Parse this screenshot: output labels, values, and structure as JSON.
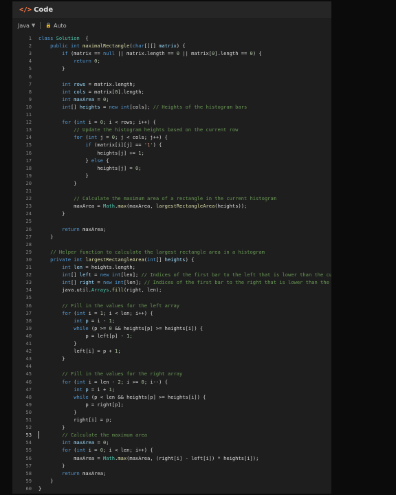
{
  "header": {
    "icon": "code-icon",
    "title": "Code"
  },
  "toolbar": {
    "language": "Java",
    "mode": "Auto"
  },
  "editor": {
    "lines": [
      {
        "n": "1",
        "t": [
          [
            "kw",
            "class "
          ],
          [
            "ty",
            "Solution"
          ],
          [
            "",
            "  {"
          ]
        ]
      },
      {
        "n": "2",
        "t": [
          [
            "",
            "    "
          ],
          [
            "kw",
            "public int "
          ],
          [
            "fn",
            "maximalRectangle"
          ],
          [
            "",
            "("
          ],
          [
            "kw",
            "char"
          ],
          [
            "",
            "[][] "
          ],
          [
            "id",
            "matrix"
          ],
          [
            "",
            ") {"
          ]
        ]
      },
      {
        "n": "3",
        "t": [
          [
            "",
            "        "
          ],
          [
            "kw",
            "if"
          ],
          [
            "",
            " (matrix == "
          ],
          [
            "kw",
            "null"
          ],
          [
            "",
            " || matrix.length == "
          ],
          [
            "num",
            "0"
          ],
          [
            "",
            " || matrix["
          ],
          [
            "num",
            "0"
          ],
          [
            "",
            "].length == "
          ],
          [
            "num",
            "0"
          ],
          [
            "",
            ") {"
          ]
        ]
      },
      {
        "n": "4",
        "t": [
          [
            "",
            "            "
          ],
          [
            "kw",
            "return "
          ],
          [
            "num",
            "0"
          ],
          [
            "",
            ";"
          ]
        ]
      },
      {
        "n": "5",
        "t": [
          [
            "",
            "        }"
          ]
        ]
      },
      {
        "n": "6",
        "t": []
      },
      {
        "n": "7",
        "t": [
          [
            "",
            "        "
          ],
          [
            "kw",
            "int "
          ],
          [
            "id",
            "rows"
          ],
          [
            "",
            " = matrix.length;"
          ]
        ]
      },
      {
        "n": "8",
        "t": [
          [
            "",
            "        "
          ],
          [
            "kw",
            "int "
          ],
          [
            "id",
            "cols"
          ],
          [
            "",
            " = matrix["
          ],
          [
            "num",
            "0"
          ],
          [
            "",
            "].length;"
          ]
        ]
      },
      {
        "n": "9",
        "t": [
          [
            "",
            "        "
          ],
          [
            "kw",
            "int "
          ],
          [
            "id",
            "maxArea"
          ],
          [
            "",
            " = "
          ],
          [
            "num",
            "0"
          ],
          [
            "",
            ";"
          ]
        ]
      },
      {
        "n": "10",
        "t": [
          [
            "",
            "        "
          ],
          [
            "kw",
            "int"
          ],
          [
            "",
            "[] "
          ],
          [
            "id",
            "heights"
          ],
          [
            "",
            " = "
          ],
          [
            "kw",
            "new int"
          ],
          [
            "",
            "[cols]; "
          ],
          [
            "cm",
            "// Heights of the histogram bars"
          ]
        ]
      },
      {
        "n": "11",
        "t": []
      },
      {
        "n": "12",
        "t": [
          [
            "",
            "        "
          ],
          [
            "kw",
            "for"
          ],
          [
            "",
            " ("
          ],
          [
            "kw",
            "int "
          ],
          [
            "",
            "i = "
          ],
          [
            "num",
            "0"
          ],
          [
            "",
            "; i < rows; i++) {"
          ]
        ]
      },
      {
        "n": "13",
        "t": [
          [
            "",
            "            "
          ],
          [
            "cm",
            "// Update the histogram heights based on the current row"
          ]
        ]
      },
      {
        "n": "14",
        "t": [
          [
            "",
            "            "
          ],
          [
            "kw",
            "for"
          ],
          [
            "",
            " ("
          ],
          [
            "kw",
            "int "
          ],
          [
            "",
            "j = "
          ],
          [
            "num",
            "0"
          ],
          [
            "",
            "; j < cols; j++) {"
          ]
        ]
      },
      {
        "n": "15",
        "t": [
          [
            "",
            "                "
          ],
          [
            "kw",
            "if"
          ],
          [
            "",
            " (matrix[i][j] == "
          ],
          [
            "str",
            "'1'"
          ],
          [
            "",
            ") {"
          ]
        ]
      },
      {
        "n": "16",
        "t": [
          [
            "",
            "                    heights[j] += "
          ],
          [
            "num",
            "1"
          ],
          [
            "",
            ";"
          ]
        ]
      },
      {
        "n": "17",
        "t": [
          [
            "",
            "                } "
          ],
          [
            "kw",
            "else"
          ],
          [
            "",
            " {"
          ]
        ]
      },
      {
        "n": "18",
        "t": [
          [
            "",
            "                    heights[j] = "
          ],
          [
            "num",
            "0"
          ],
          [
            "",
            ";"
          ]
        ]
      },
      {
        "n": "19",
        "t": [
          [
            "",
            "                }"
          ]
        ]
      },
      {
        "n": "20",
        "t": [
          [
            "",
            "            }"
          ]
        ]
      },
      {
        "n": "21",
        "t": []
      },
      {
        "n": "22",
        "t": [
          [
            "",
            "            "
          ],
          [
            "cm",
            "// Calculate the maximum area of a rectangle in the current histogram"
          ]
        ]
      },
      {
        "n": "23",
        "t": [
          [
            "",
            "            maxArea = "
          ],
          [
            "ty",
            "Math"
          ],
          [
            "",
            "."
          ],
          [
            "fn",
            "max"
          ],
          [
            "",
            "(maxArea, "
          ],
          [
            "fn",
            "largestRectangleArea"
          ],
          [
            "",
            "(heights));"
          ]
        ]
      },
      {
        "n": "24",
        "t": [
          [
            "",
            "        }"
          ]
        ]
      },
      {
        "n": "25",
        "t": []
      },
      {
        "n": "26",
        "t": [
          [
            "",
            "        "
          ],
          [
            "kw",
            "return "
          ],
          [
            "",
            "maxArea;"
          ]
        ]
      },
      {
        "n": "27",
        "t": [
          [
            "",
            "    }"
          ]
        ]
      },
      {
        "n": "28",
        "t": []
      },
      {
        "n": "29",
        "t": [
          [
            "",
            "    "
          ],
          [
            "cm",
            "// Helper function to calculate the largest rectangle area in a histogram"
          ]
        ]
      },
      {
        "n": "30",
        "t": [
          [
            "",
            "    "
          ],
          [
            "kw",
            "private int "
          ],
          [
            "fn",
            "largestRectangleArea"
          ],
          [
            "",
            "("
          ],
          [
            "kw",
            "int"
          ],
          [
            "",
            "[] "
          ],
          [
            "id",
            "heights"
          ],
          [
            "",
            ") {"
          ]
        ]
      },
      {
        "n": "31",
        "t": [
          [
            "",
            "        "
          ],
          [
            "kw",
            "int "
          ],
          [
            "id",
            "len"
          ],
          [
            "",
            " = heights.length;"
          ]
        ]
      },
      {
        "n": "32",
        "t": [
          [
            "",
            "        "
          ],
          [
            "kw",
            "int"
          ],
          [
            "",
            "[] "
          ],
          [
            "id",
            "left"
          ],
          [
            "",
            " = "
          ],
          [
            "kw",
            "new int"
          ],
          [
            "",
            "[len]; "
          ],
          [
            "cm",
            "// Indices of the first bar to the left that is lower than the current bar"
          ]
        ]
      },
      {
        "n": "33",
        "t": [
          [
            "",
            "        "
          ],
          [
            "kw",
            "int"
          ],
          [
            "",
            "[] "
          ],
          [
            "id",
            "right"
          ],
          [
            "",
            " = "
          ],
          [
            "kw",
            "new int"
          ],
          [
            "",
            "[len]; "
          ],
          [
            "cm",
            "// Indices of the first bar to the right that is lower than the current bar"
          ]
        ]
      },
      {
        "n": "34",
        "t": [
          [
            "",
            "        java.util."
          ],
          [
            "ty",
            "Arrays"
          ],
          [
            "",
            "."
          ],
          [
            "fn",
            "fill"
          ],
          [
            "",
            "(right, len);"
          ]
        ]
      },
      {
        "n": "35",
        "t": []
      },
      {
        "n": "36",
        "t": [
          [
            "",
            "        "
          ],
          [
            "cm",
            "// Fill in the values for the left array"
          ]
        ]
      },
      {
        "n": "37",
        "t": [
          [
            "",
            "        "
          ],
          [
            "kw",
            "for"
          ],
          [
            "",
            " ("
          ],
          [
            "kw",
            "int "
          ],
          [
            "",
            "i = "
          ],
          [
            "num",
            "1"
          ],
          [
            "",
            "; i < len; i++) {"
          ]
        ]
      },
      {
        "n": "38",
        "t": [
          [
            "",
            "            "
          ],
          [
            "kw",
            "int "
          ],
          [
            "id",
            "p"
          ],
          [
            "",
            " = i - "
          ],
          [
            "num",
            "1"
          ],
          [
            "",
            ";"
          ]
        ]
      },
      {
        "n": "39",
        "t": [
          [
            "",
            "            "
          ],
          [
            "kw",
            "while"
          ],
          [
            "",
            " (p >= "
          ],
          [
            "num",
            "0"
          ],
          [
            "",
            " && heights[p] >= heights[i]) {"
          ]
        ]
      },
      {
        "n": "40",
        "t": [
          [
            "",
            "                p = left[p] - "
          ],
          [
            "num",
            "1"
          ],
          [
            "",
            ";"
          ]
        ]
      },
      {
        "n": "41",
        "t": [
          [
            "",
            "            }"
          ]
        ]
      },
      {
        "n": "42",
        "t": [
          [
            "",
            "            left[i] = p + "
          ],
          [
            "num",
            "1"
          ],
          [
            "",
            ";"
          ]
        ]
      },
      {
        "n": "43",
        "t": [
          [
            "",
            "        }"
          ]
        ]
      },
      {
        "n": "44",
        "t": []
      },
      {
        "n": "45",
        "t": [
          [
            "",
            "        "
          ],
          [
            "cm",
            "// Fill in the values for the right array"
          ]
        ]
      },
      {
        "n": "46",
        "t": [
          [
            "",
            "        "
          ],
          [
            "kw",
            "for"
          ],
          [
            "",
            " ("
          ],
          [
            "kw",
            "int "
          ],
          [
            "",
            "i = len - "
          ],
          [
            "num",
            "2"
          ],
          [
            "",
            "; i >= "
          ],
          [
            "num",
            "0"
          ],
          [
            "",
            "; i--) {"
          ]
        ]
      },
      {
        "n": "47",
        "t": [
          [
            "",
            "            "
          ],
          [
            "kw",
            "int "
          ],
          [
            "id",
            "p"
          ],
          [
            "",
            " = i + "
          ],
          [
            "num",
            "1"
          ],
          [
            "",
            ";"
          ]
        ]
      },
      {
        "n": "48",
        "t": [
          [
            "",
            "            "
          ],
          [
            "kw",
            "while"
          ],
          [
            "",
            " (p < len && heights[p] >= heights[i]) {"
          ]
        ]
      },
      {
        "n": "49",
        "t": [
          [
            "",
            "                p = right[p];"
          ]
        ]
      },
      {
        "n": "50",
        "t": [
          [
            "",
            "            }"
          ]
        ]
      },
      {
        "n": "51",
        "t": [
          [
            "",
            "            right[i] = p;"
          ]
        ]
      },
      {
        "n": "52",
        "t": [
          [
            "",
            "        }"
          ]
        ]
      },
      {
        "n": "53",
        "t": [
          [
            "",
            "        "
          ],
          [
            "cm",
            "// Calculate the maximum area"
          ]
        ]
      },
      {
        "n": "54",
        "t": [
          [
            "",
            "        "
          ],
          [
            "kw",
            "int "
          ],
          [
            "id",
            "maxArea"
          ],
          [
            "",
            " = "
          ],
          [
            "num",
            "0"
          ],
          [
            "",
            ";"
          ]
        ]
      },
      {
        "n": "55",
        "t": [
          [
            "",
            "        "
          ],
          [
            "kw",
            "for"
          ],
          [
            "",
            " ("
          ],
          [
            "kw",
            "int "
          ],
          [
            "",
            "i = "
          ],
          [
            "num",
            "0"
          ],
          [
            "",
            "; i < len; i++) {"
          ]
        ]
      },
      {
        "n": "56",
        "t": [
          [
            "",
            "            maxArea = "
          ],
          [
            "ty",
            "Math"
          ],
          [
            "",
            "."
          ],
          [
            "fn",
            "max"
          ],
          [
            "",
            "(maxArea, (right[i] - left[i]) * heights[i]);"
          ]
        ]
      },
      {
        "n": "57",
        "t": [
          [
            "",
            "        }"
          ]
        ]
      },
      {
        "n": "58",
        "t": [
          [
            "",
            "        "
          ],
          [
            "kw",
            "return "
          ],
          [
            "",
            "maxArea;"
          ]
        ]
      },
      {
        "n": "59",
        "t": [
          [
            "",
            "    }"
          ]
        ]
      },
      {
        "n": "60",
        "t": [
          [
            "",
            "}"
          ]
        ]
      }
    ],
    "active_line": "53"
  }
}
